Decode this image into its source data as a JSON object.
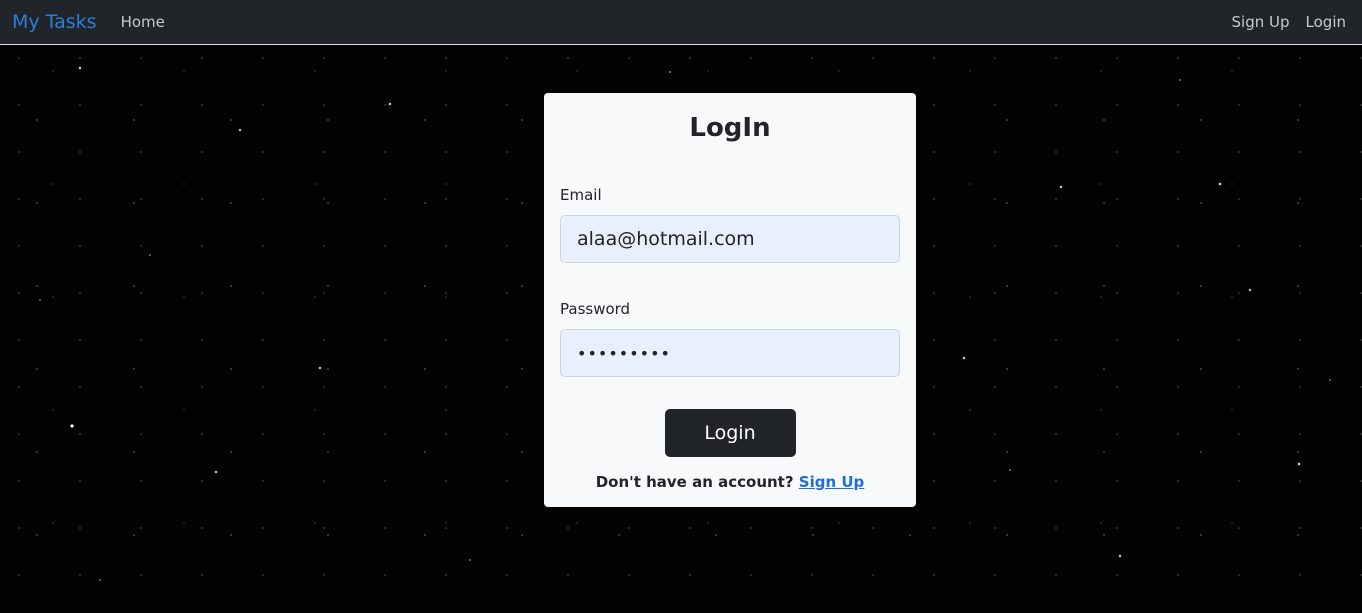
{
  "navbar": {
    "brand": "My Tasks",
    "home": "Home",
    "signup": "Sign Up",
    "login": "Login"
  },
  "login_card": {
    "title": "LogIn",
    "email_label": "Email",
    "email_value": "alaa@hotmail.com",
    "password_label": "Password",
    "password_value": "•••••••••",
    "submit_label": "Login",
    "signup_prompt": "Don't have an account?",
    "signup_link": "Sign Up"
  },
  "colors": {
    "navbar_bg": "#212529",
    "brand": "#2b7fd6",
    "card_bg": "#f8f9fa",
    "input_bg": "#e8f0fe",
    "button_bg": "#212529",
    "link": "#1f6fd1"
  }
}
